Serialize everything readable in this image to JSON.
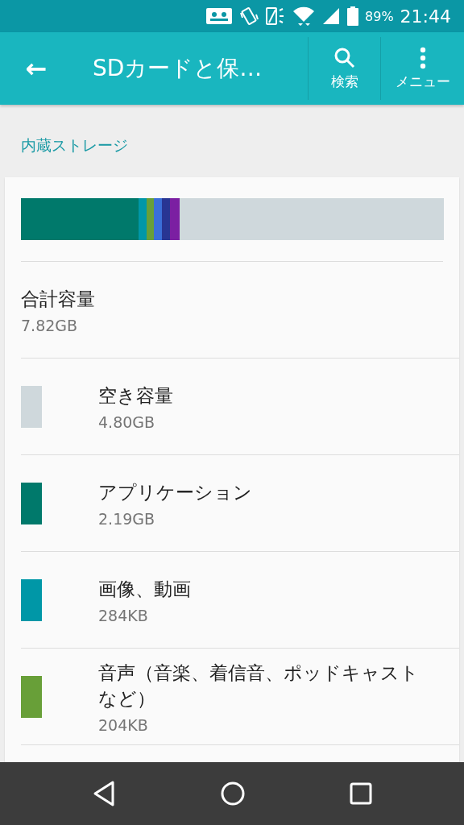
{
  "status_bar": {
    "battery": "89%",
    "time": "21:44"
  },
  "toolbar": {
    "back": "←",
    "title": "SDカードと保…",
    "actions": [
      {
        "kind": "search",
        "label": "検索"
      },
      {
        "kind": "menu",
        "label": "メニュー"
      }
    ]
  },
  "section_header": "内蔵ストレージ",
  "storage_bar": {
    "segments": [
      {
        "color": "#00796b"
      },
      {
        "color": "#0097a7"
      },
      {
        "color": "#689f38"
      },
      {
        "color": "#3a6fd8"
      },
      {
        "color": "#283593"
      },
      {
        "color": "#7b1fa2"
      },
      {
        "color": "#cfd8dc"
      }
    ]
  },
  "total": {
    "label": "合計容量",
    "value": "7.82GB"
  },
  "items": [
    {
      "label": "空き容量",
      "value": "4.80GB",
      "color": "#cfd8dc"
    },
    {
      "label": "アプリケーション",
      "value": "2.19GB",
      "color": "#00796b"
    },
    {
      "label": "画像、動画",
      "value": "284KB",
      "color": "#0097a7"
    },
    {
      "label": "音声（音楽、着信音、ポッドキャストなど）",
      "value": "204KB",
      "color": "#689f38"
    }
  ]
}
